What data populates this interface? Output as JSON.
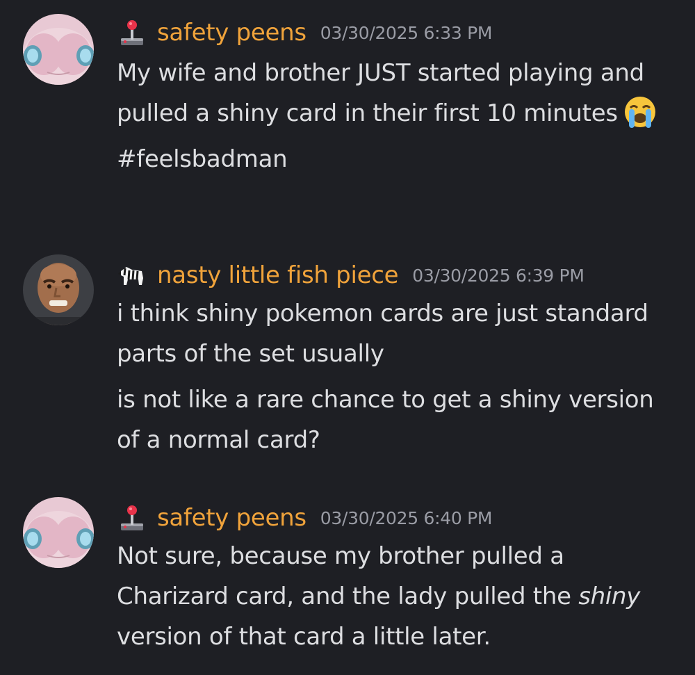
{
  "messages": [
    {
      "username": "safety peens",
      "timestamp": "03/30/2025 6:33 PM",
      "role_icon": "joystick-icon",
      "avatar": "pink-creature-avatar",
      "paragraphs": [
        {
          "text": "My wife and brother JUST started playing and pulled a shiny card in their first 10 minutes",
          "emoji": "loudly-crying-face-emoji"
        },
        {
          "text": "#feelsbadman"
        }
      ]
    },
    {
      "username": "nasty little fish piece",
      "timestamp": "03/30/2025 6:39 PM",
      "role_icon": "zebra-icon",
      "avatar": "bald-man-3d-avatar",
      "paragraphs": [
        {
          "text": "i think shiny pokemon cards are just standard parts of the set usually"
        },
        {
          "text": "is not like a rare chance to get a shiny version of a normal card?"
        }
      ]
    },
    {
      "username": "safety peens",
      "timestamp": "03/30/2025 6:40 PM",
      "role_icon": "joystick-icon",
      "avatar": "pink-creature-avatar",
      "paragraphs": [
        {
          "text_before": "Not sure, because my brother pulled a Charizard card, and the lady pulled the ",
          "text_italic": "shiny",
          "text_after": " version of that card a little later."
        }
      ]
    }
  ],
  "colors": {
    "background": "#1e1f24",
    "username": "#f0a33b",
    "timestamp": "#9a9ca5",
    "text": "#dddee1"
  }
}
